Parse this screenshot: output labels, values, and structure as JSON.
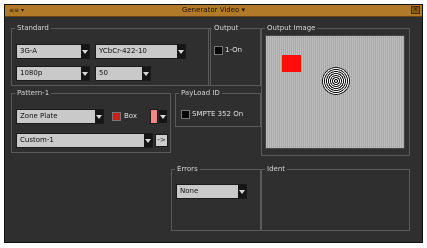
{
  "window": {
    "menu_label": "≡≡ ▾",
    "title": "Generator Video ▾",
    "close_label": "×"
  },
  "standard": {
    "label": "Standard",
    "format": "3G-A",
    "color_space": "YCbCr-422-10",
    "resolution": "1080p",
    "rate": "50"
  },
  "output": {
    "label": "Output",
    "checkbox_label": "1-On"
  },
  "output_image": {
    "label": "Output Image"
  },
  "pattern": {
    "label": "Pattern-1",
    "value": "Zone Plate",
    "box_label": "Box",
    "custom_value": "Custom-1",
    "go_label": "->"
  },
  "payload": {
    "label": "PayLoad ID",
    "checkbox_label": "SMPTE 352 On"
  },
  "errors": {
    "label": "Errors",
    "value": "None"
  },
  "ident": {
    "label": "Ident"
  },
  "colors": {
    "titlebar": "#b07a28",
    "panel": "#2f2f2f",
    "combo": "#c9c9c9",
    "box_swatch": "#f08a8a",
    "red_square": "#ff0d0d",
    "box_check": "#d21c1c"
  }
}
